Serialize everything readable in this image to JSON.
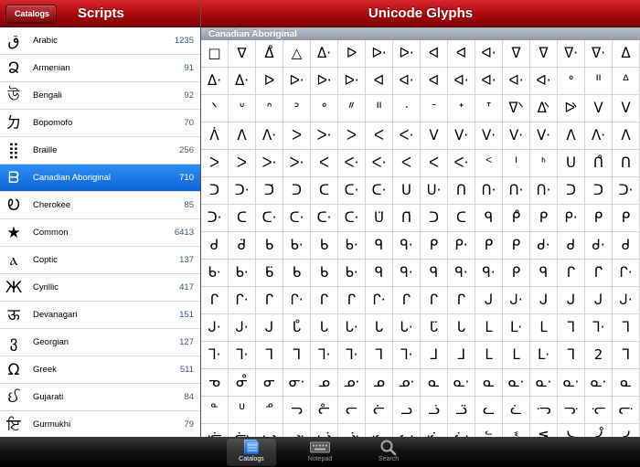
{
  "left": {
    "back_label": "Catalogs",
    "title": "Scripts",
    "scripts": [
      {
        "glyph": "ق",
        "name": "Arabic",
        "count": "1235"
      },
      {
        "glyph": "Ձ",
        "name": "Armenian",
        "count": "91"
      },
      {
        "glyph": "উ",
        "name": "Bengali",
        "count": "92"
      },
      {
        "glyph": "ㄉ",
        "name": "Bopomofo",
        "count": "70"
      },
      {
        "glyph": "⣿",
        "name": "Braille",
        "count": "256"
      },
      {
        "glyph": "ᗷ",
        "name": "Canadian Aboriginal",
        "count": "710"
      },
      {
        "glyph": "Ꭷ",
        "name": "Cherokee",
        "count": "85"
      },
      {
        "glyph": "★",
        "name": "Common",
        "count": "6413"
      },
      {
        "glyph": "ⲁ",
        "name": "Coptic",
        "count": "137"
      },
      {
        "glyph": "Ж",
        "name": "Cyrillic",
        "count": "417"
      },
      {
        "glyph": "ऊ",
        "name": "Devanagari",
        "count": "151"
      },
      {
        "glyph": "ვ",
        "name": "Georgian",
        "count": "127"
      },
      {
        "glyph": "Ω",
        "name": "Greek",
        "count": "511"
      },
      {
        "glyph": "ઈ",
        "name": "Gujarati",
        "count": "84"
      },
      {
        "glyph": "ਇ",
        "name": "Gurmukhi",
        "count": "79"
      }
    ]
  },
  "right": {
    "title": "Unicode Glyphs",
    "section": "Canadian Aboriginal",
    "rows": [
      [
        "□",
        "∇",
        "ᐃ̊",
        "△",
        "ᐃ·",
        "ᐅ",
        "ᐅ·",
        "ᐅ·",
        "ᐊ",
        "ᐊ",
        "ᐊ·",
        "ᐁ",
        "ᐁ",
        "ᐁ·",
        "ᐁ·",
        "ᐃ"
      ],
      [
        "ᐃ·",
        "ᐃ·",
        "ᐅ",
        "ᐅ·",
        "ᐅ·",
        "ᐅ·",
        "ᐊ",
        "ᐊ·",
        "ᐊ",
        "ᐊ·",
        "ᐊ·",
        "ᐊ·",
        "ᐊ·",
        "ᐤ",
        "ᐦ",
        "ᐞ"
      ],
      [
        "ᐠ",
        "ᐡ",
        "ᐢ",
        "ᐣ",
        "ᐤ",
        "ᐥ",
        "ᐦ",
        "ᐧ",
        "ᐨ",
        "ᐩ",
        "ᐪ",
        "ᐫ",
        "ᐬ",
        "ᐭ",
        "ᐯ",
        "ᐯ"
      ],
      [
        "ᐲ",
        "ᐱ",
        "ᐱ·",
        "ᐳ",
        "ᐳ·",
        "ᐳ",
        "ᐸ",
        "ᐸ·",
        "ᐯ",
        "ᐯ·",
        "ᐯ·",
        "ᐯ·",
        "ᐯ·",
        "ᐱ",
        "ᐱ·",
        "ᐱ"
      ],
      [
        "ᐳ",
        "ᐳ",
        "ᐳ·",
        "ᐳ·",
        "ᐸ",
        "ᐸ·",
        "ᐸ·",
        "ᐸ",
        "ᐸ",
        "ᐸ·",
        "ᑉ",
        "ᑊ",
        "ᑋ",
        "ᑌ",
        "ᑎ̊",
        "ᑎ"
      ],
      [
        "ᑐ",
        "ᑐ·",
        "ᑐ̈",
        "ᑐ",
        "ᑕ",
        "ᑕ·",
        "ᑕ·",
        "ᑌ",
        "ᑌ·",
        "ᑎ",
        "ᑎ·",
        "ᑎ·",
        "ᑎ·",
        "ᑐ",
        "ᑐ",
        "ᑐ·"
      ],
      [
        "ᑐ·",
        "ᑕ",
        "ᑕ·",
        "ᑕ·",
        "ᑕ·",
        "ᑕ·",
        "ᑌ̈",
        "ᑎ̈",
        "ᑐ",
        "ᑕ",
        "ᑫ",
        "ᑭ̊",
        "ᑭ",
        "ᑭ·",
        "ᑭ",
        "ᑭ"
      ],
      [
        "ᑯ",
        "ᑯ̈",
        "ᑲ",
        "ᑲ·",
        "ᑲ",
        "ᑲ·",
        "ᑫ",
        "ᑫ·",
        "ᑭ",
        "ᑭ·",
        "ᑭ",
        "ᑭ",
        "ᑯ·",
        "ᑯ",
        "ᑯ·",
        "ᑯ"
      ],
      [
        "ᑲ·",
        "ᑲ·",
        "ᑲ̈",
        "ᑲ",
        "ᑲ",
        "ᑲ·",
        "ᑫ",
        "ᑫ·",
        "ᑫ",
        "ᑫ·",
        "ᑫ·",
        "ᑭ",
        "ᑫ",
        "ᒋ",
        "ᒋ̈",
        "ᒋ·"
      ],
      [
        "ᒋ",
        "ᒋ·",
        "ᒋ",
        "ᒋ·",
        "ᒋ",
        "ᒋ",
        "ᒋ·",
        "ᒋ",
        "ᒋ",
        "ᒋ",
        "ᒍ",
        "ᒍ·",
        "ᒍ",
        "ᒍ",
        "ᒍ",
        "ᒍ·"
      ],
      [
        "ᒍ·",
        "ᒍ·",
        "ᒍ",
        "ᒐ̊",
        "ᒐ",
        "ᒐ·",
        "ᒐ",
        "ᒐ·",
        "ᒐ̈",
        "ᒐ",
        "ᒪ",
        "ᒪ·",
        "ᒪ",
        "ᒣ",
        "ᒣ·",
        "ᒣ"
      ],
      [
        "ᒣ·",
        "ᒣ·",
        "ᒣ",
        "ᒣ",
        "ᒣ·",
        "ᒣ·",
        "ᒣ",
        "ᒣ·",
        "ᒧ",
        "ᒧ",
        "ᒪ",
        "ᒪ",
        "ᒪ·",
        "ᒣ",
        "2",
        "ᒣ"
      ],
      [
        "ᓀ",
        "ᓂ̊",
        "ᓂ",
        "ᓂ·",
        "ᓄ",
        "ᓄ·",
        "ᓄ",
        "ᓄ·",
        "ᓇ",
        "ᓇ·",
        "ᓇ",
        "ᓇ·",
        "ᓇ·",
        "ᓇ·",
        "ᓇ·",
        "ᓇ"
      ],
      [
        "ᓐ",
        "ᓑ",
        "ᓒ",
        "ᓓ",
        "ᓔ",
        "ᓕ",
        "ᓖ",
        "ᓗ",
        "ᓘ",
        "ᓙ",
        "ᓚ",
        "ᓛ",
        "ᓜ",
        "ᓝ",
        "ᓞ",
        "ᓟ"
      ],
      [
        "ᓠ",
        "ᓡ",
        "ᓢ",
        "ᓣ",
        "ᓤ",
        "ᓥ",
        "ᓦ",
        "ᓧ",
        "ᓨ",
        "ᓩ",
        "ᓪ",
        "ᓫ",
        "ᓬ",
        "ᓭ",
        "ᓮ",
        "ᓯ"
      ]
    ]
  },
  "tabs": [
    {
      "label": "Catalogs",
      "icon": "catalogs-icon",
      "active": true
    },
    {
      "label": "Notepad",
      "icon": "keyboard-icon",
      "active": false
    },
    {
      "label": "Search",
      "icon": "search-icon",
      "active": false
    }
  ],
  "colors": {
    "header_red": "#a8090e",
    "selection_blue": "#1a78e6",
    "count_text": "#3a5680"
  }
}
